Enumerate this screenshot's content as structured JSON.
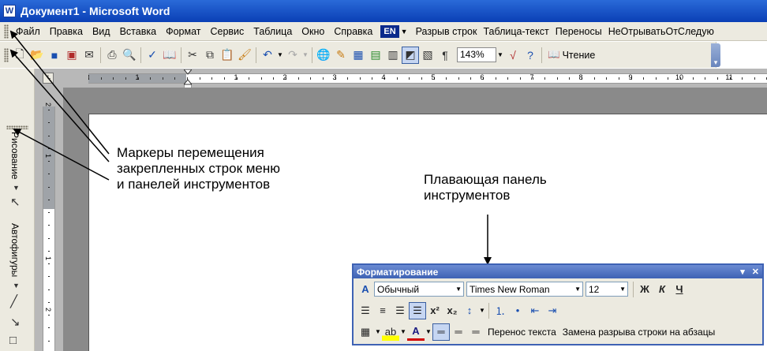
{
  "window": {
    "title": "Документ1 - Microsoft Word",
    "icon": "word-doc-icon"
  },
  "menu": {
    "items": [
      "Файл",
      "Правка",
      "Вид",
      "Вставка",
      "Формат",
      "Сервис",
      "Таблица",
      "Окно",
      "Справка"
    ],
    "language_badge": "EN",
    "macros": [
      "Разрыв строк",
      "Таблица-текст",
      "Переносы",
      "НеОтрывать",
      "ОтСледую"
    ]
  },
  "standard_toolbar": {
    "zoom": "143%",
    "read_label": "Чтение"
  },
  "left_toolbar": {
    "drawing_label": "Рисование",
    "autoshapes_label": "Автофигуры"
  },
  "ruler": {
    "h_numbers": [
      "2",
      "1",
      "1",
      "2",
      "3",
      "4",
      "5",
      "6",
      "7",
      "8",
      "9",
      "10",
      "11"
    ],
    "v_numbers": [
      "2",
      "1",
      "1",
      "2"
    ]
  },
  "annotations": {
    "markers": [
      "Маркеры перемещения",
      "закрепленных строк меню",
      "и панелей инструментов"
    ],
    "floating": [
      "Плавающая панель",
      "инструментов"
    ]
  },
  "formatting_toolbar": {
    "title": "Форматирование",
    "style": "Обычный",
    "font": "Times New Roman",
    "size": "12",
    "bold_label": "Ж",
    "italic_label": "К",
    "underline_label": "Ч",
    "wrap_text": "Перенос текста",
    "replace_breaks": "Замена разрыва строки на абзацы"
  }
}
